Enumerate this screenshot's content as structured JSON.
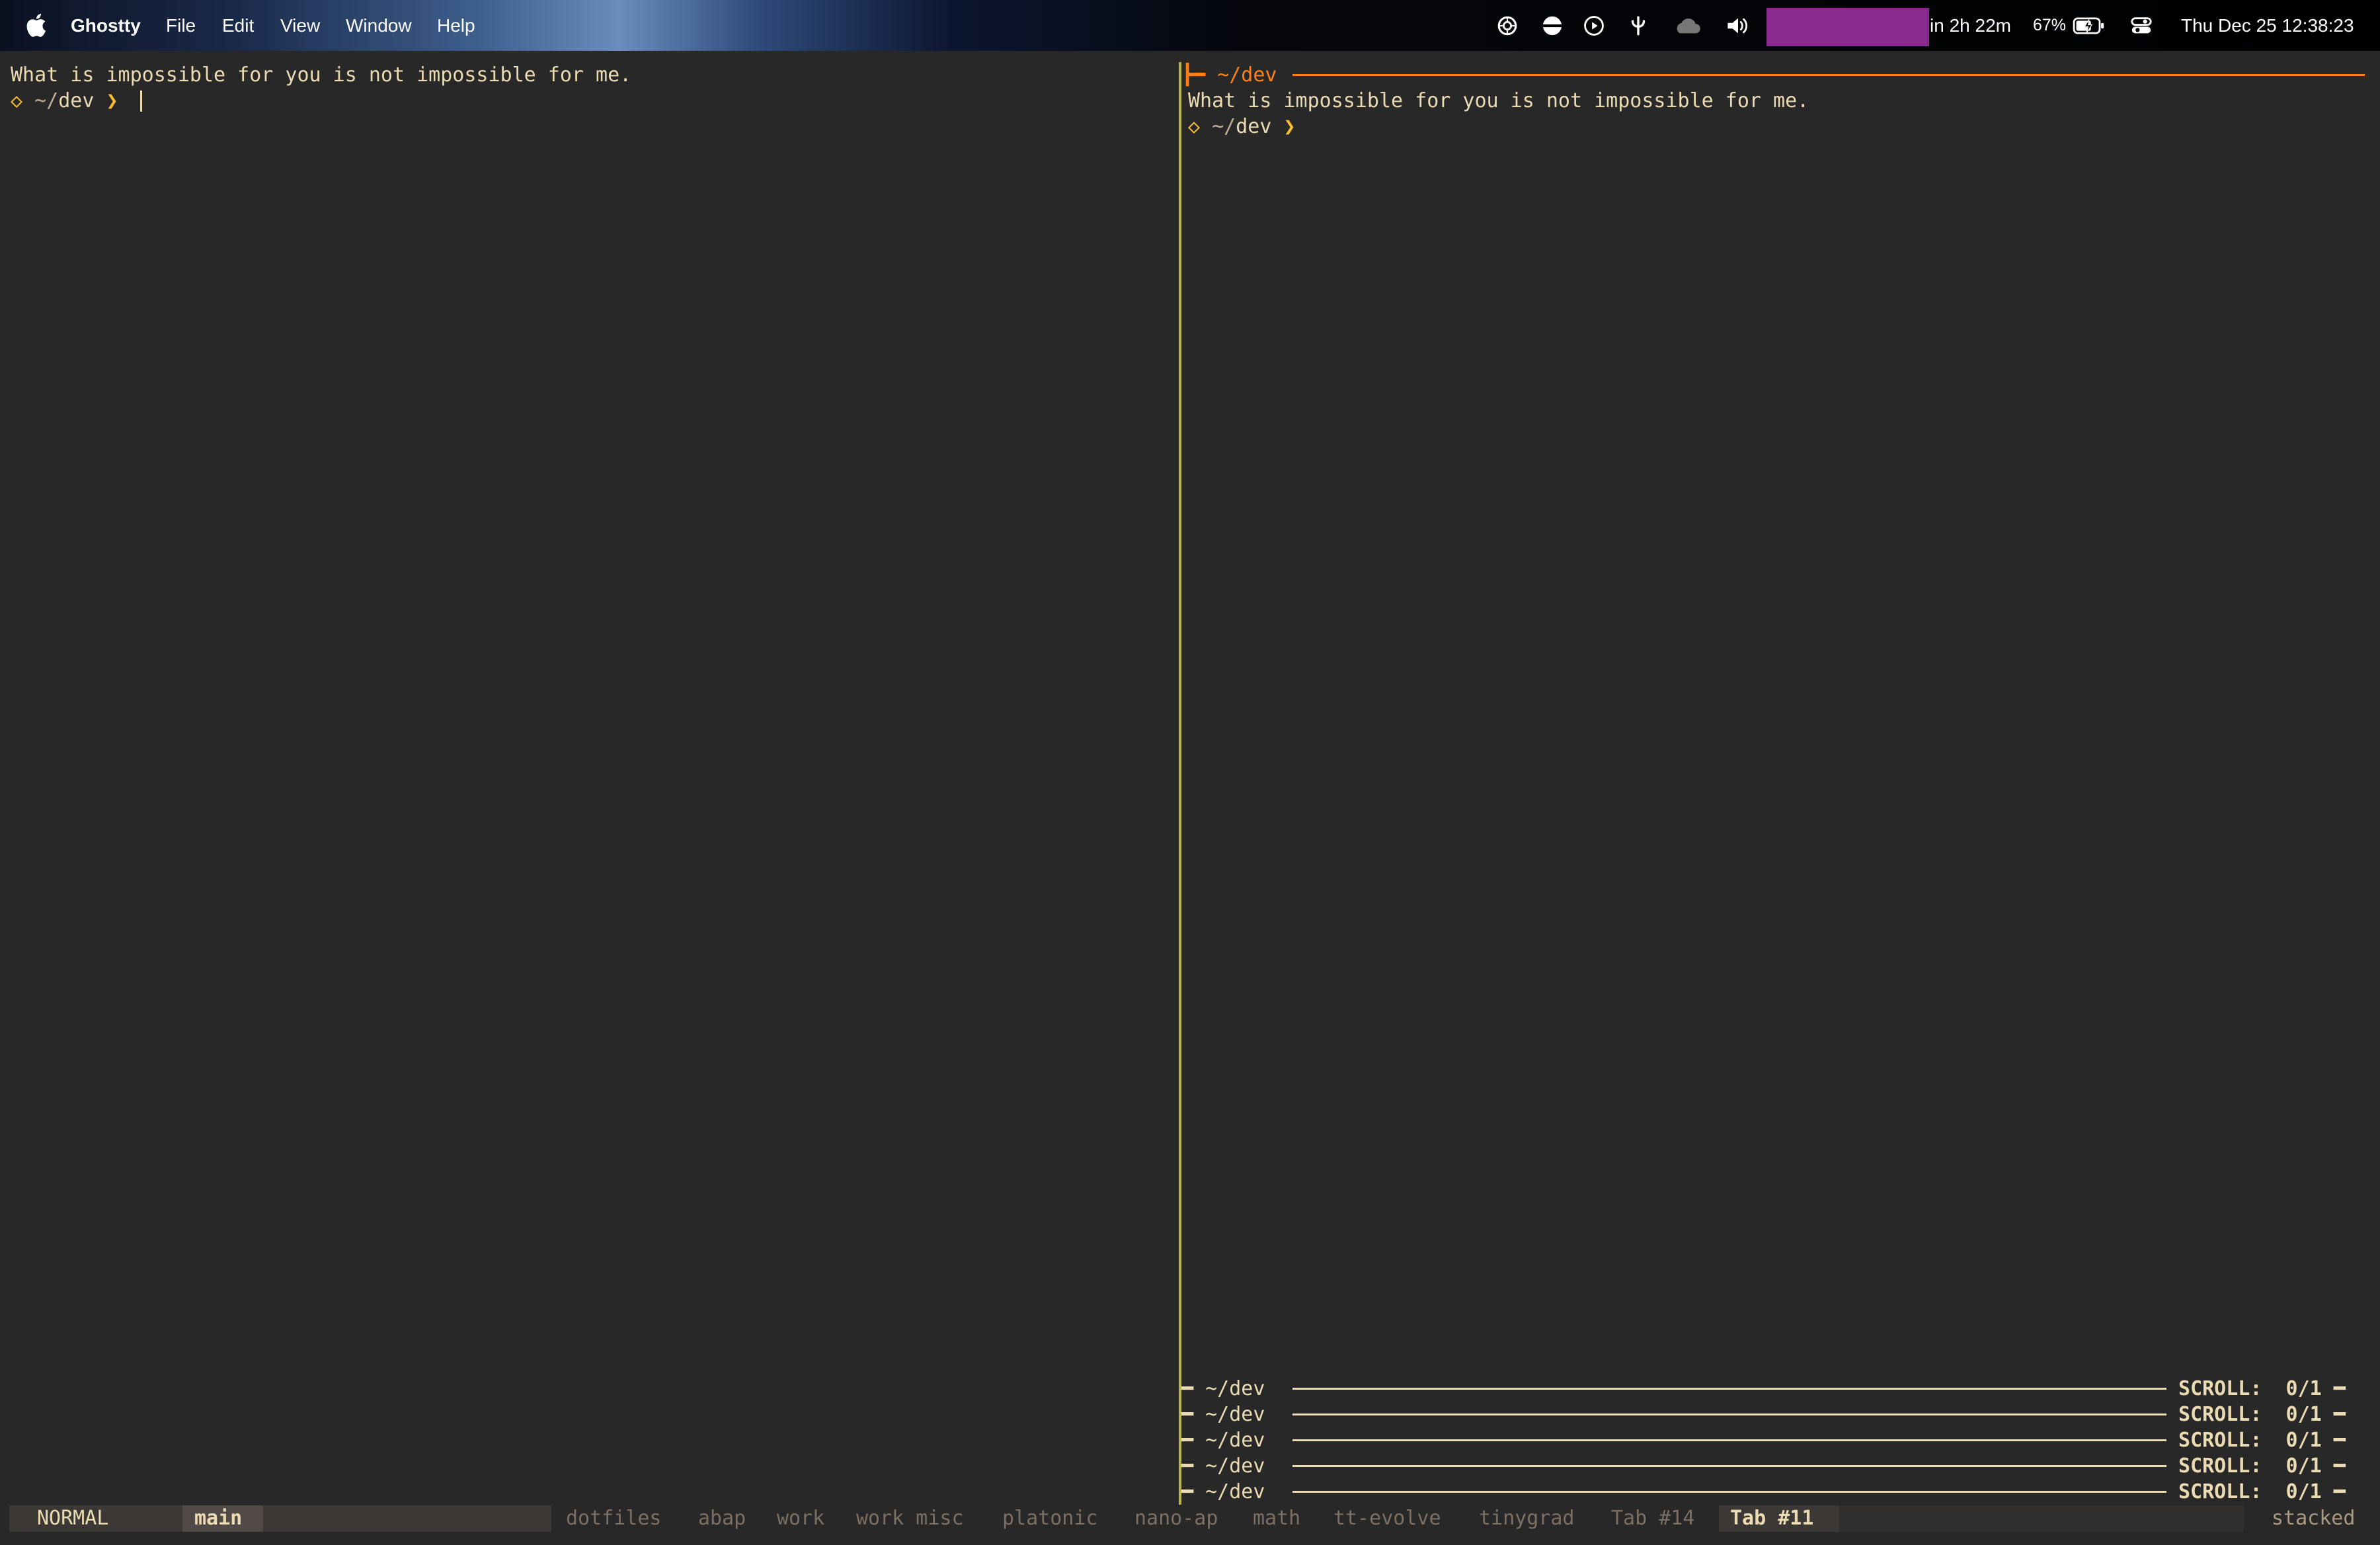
{
  "menubar": {
    "app_name": "Ghostty",
    "menus": [
      "File",
      "Edit",
      "View",
      "Window",
      "Help"
    ],
    "event_countdown": "in 2h 22m",
    "battery_percent": "67%",
    "datetime": "Thu Dec 25  12:38:23",
    "tray_icons": [
      "chatgpt-icon",
      "menu-circle-icon",
      "play-icon",
      "fork-icon",
      "cloud-icon",
      "volume-icon"
    ]
  },
  "left_pane": {
    "message": "What is impossible for you is not impossible for me.",
    "prompt_symbol": "◇",
    "prompt_path_prefix": "~/",
    "prompt_path_dir": "dev",
    "prompt_arrow": "❯"
  },
  "right_pane": {
    "header": "~/dev",
    "header_prefix": "┣━",
    "message": "What is impossible for you is not impossible for me.",
    "prompt_symbol": "◇",
    "prompt_path_prefix": "~/",
    "prompt_path_dir": "dev",
    "prompt_arrow": "❯",
    "stacked_panes": [
      {
        "title": "~/dev",
        "scroll": "SCROLL:  0/1"
      },
      {
        "title": "~/dev",
        "scroll": "SCROLL:  0/1"
      },
      {
        "title": "~/dev",
        "scroll": "SCROLL:  0/1"
      },
      {
        "title": "~/dev",
        "scroll": "SCROLL:  0/1"
      },
      {
        "title": "~/dev",
        "scroll": "SCROLL:  0/1"
      }
    ]
  },
  "statusbar": {
    "mode": "NORMAL",
    "session": "main",
    "tabs": [
      {
        "label": "dotfiles",
        "active": false
      },
      {
        "label": "abap",
        "active": false
      },
      {
        "label": "work",
        "active": false
      },
      {
        "label": "work misc",
        "active": false
      },
      {
        "label": "platonic",
        "active": false
      },
      {
        "label": "nano-ap",
        "active": false
      },
      {
        "label": "math",
        "active": false
      },
      {
        "label": "tt-evolve",
        "active": false
      },
      {
        "label": "tinygrad",
        "active": false
      },
      {
        "label": "Tab #14",
        "active": false
      },
      {
        "label": "Tab #11",
        "active": true
      }
    ],
    "layout": "stacked"
  },
  "colors": {
    "background": "#282828",
    "foreground": "#ebdbb2",
    "accent_yellow": "#fabd2f",
    "accent_orange": "#fe8019",
    "divider": "#b8b34a",
    "redaction": "#8a2b8f"
  }
}
